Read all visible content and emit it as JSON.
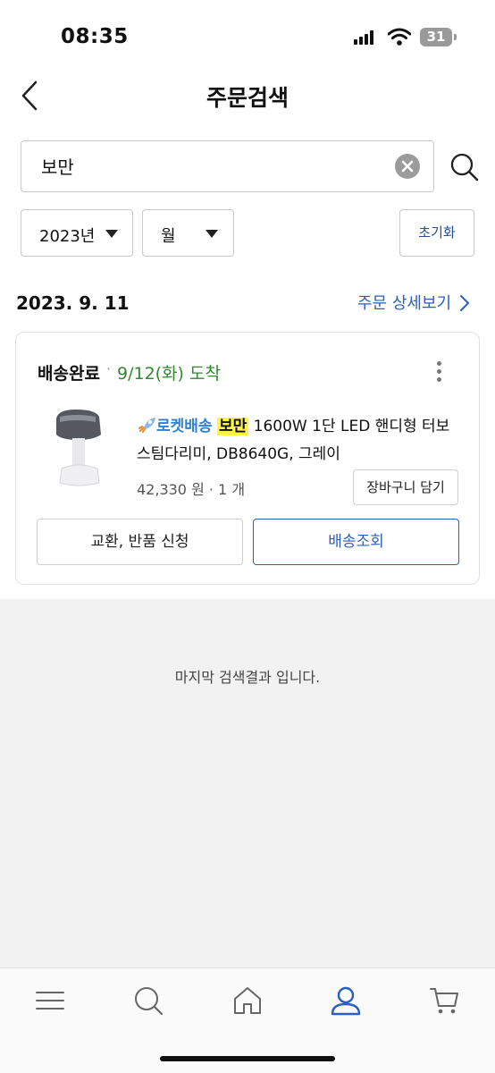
{
  "status_bar": {
    "time": "08:35",
    "battery": "31"
  },
  "header": {
    "title": "주문검색"
  },
  "search": {
    "value": "보만",
    "placeholder": ""
  },
  "filters": {
    "year": "2023년",
    "month": "월",
    "reset_label": "초기화"
  },
  "order": {
    "date": "2023. 9. 11",
    "detail_link": "주문 상세보기",
    "status": "배송완료",
    "status_separator": "·",
    "arrival": "9/12(화) 도착",
    "product": {
      "rocket_label": "로켓배송",
      "highlight": "보만",
      "name_line1_rest": " 1600W 1단 LED 핸디형 터보",
      "name_line2": "스팀다리미, DB8640G, 그레이",
      "price": "42,330 원 · 1 개"
    },
    "cart_button": "장바구니 담기",
    "exchange_button": "교환, 반품 신청",
    "track_button": "배송조회"
  },
  "end_message": "마지막 검색결과 입니다.",
  "tabbar": [
    "menu-icon",
    "search-icon",
    "home-icon",
    "my-icon",
    "cart-icon"
  ],
  "colors": {
    "accent": "#2a5fbf",
    "arrival": "#2e8b2e",
    "rocket": "#2f7fd3",
    "highlight": "#fff34a"
  }
}
